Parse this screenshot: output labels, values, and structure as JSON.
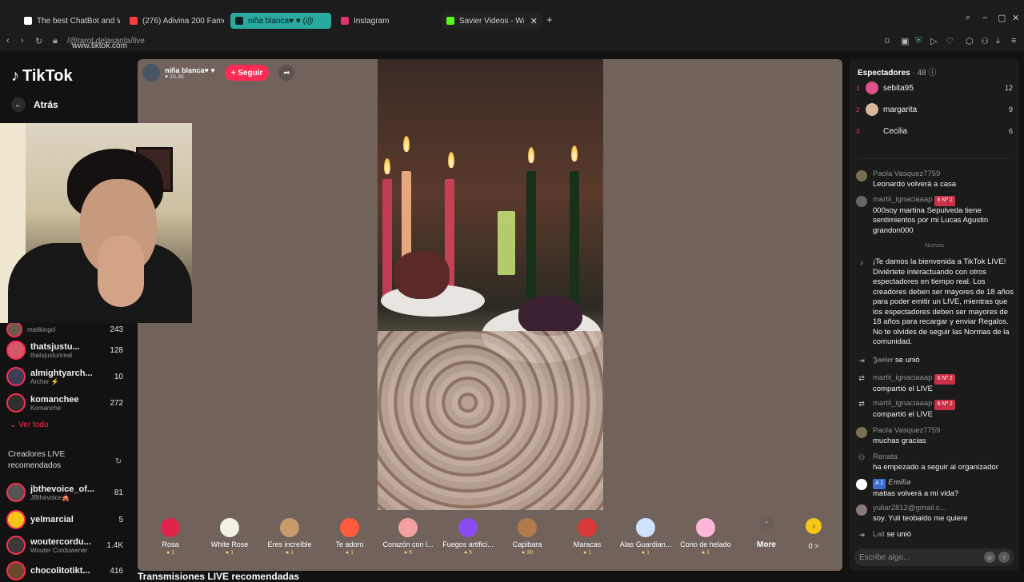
{
  "browser": {
    "tabs": [
      {
        "title": "The best ChatBot and Wr",
        "color": "#ffffff"
      },
      {
        "title": "(276) Adivina 200 Famos",
        "color": "#ff3d3d"
      },
      {
        "title": "niña blanca♥ ♥ (@",
        "color": "#ffffff"
      },
      {
        "title": "Instagram",
        "color": "#e1306c"
      },
      {
        "title": "Savier Videos - Watc",
        "color": "#53fc18"
      }
    ],
    "new_tab": "+",
    "close_tab": "✕",
    "url_host": "www.tiktok.com",
    "url_path": "/@tarot.delasanta/live"
  },
  "sidebar": {
    "brand": "TikTok",
    "back_label": "Atrás",
    "creators": [
      {
        "name": "matikingcl",
        "sub": "",
        "count": "243"
      },
      {
        "name": "thatsjustu...",
        "sub": "thatsjustunreal",
        "count": "128"
      },
      {
        "name": "almightyarch...",
        "sub": "Archer ⚡",
        "count": "10"
      },
      {
        "name": "komanchee",
        "sub": "Komanche",
        "count": "272"
      }
    ],
    "see_all": "Ver todo",
    "recommended_title": "Creadores LIVE recomendados",
    "recommended": [
      {
        "name": "jbthevoice_of...",
        "sub": "JBthevoice🎪",
        "count": "81"
      },
      {
        "name": "yelmarcial",
        "sub": "",
        "count": "5"
      },
      {
        "name": "woutercordu...",
        "sub": "Wouter Corduwener",
        "count": "1.4K"
      },
      {
        "name": "chocolitotikt...",
        "sub": "",
        "count": "416"
      }
    ]
  },
  "stream": {
    "host_name": "niña blanca♥ ♥",
    "host_likes": "♥ 16.3K",
    "follow_label": "+ Seguir",
    "below_title": "Transmisiones LIVE recomendadas"
  },
  "gifts": [
    {
      "label": "Rosa",
      "price": "1",
      "color": "#e0244c"
    },
    {
      "label": "White Rose",
      "price": "1",
      "color": "#f1f1e6"
    },
    {
      "label": "Eres increíble",
      "price": "1",
      "color": "#c79a6a"
    },
    {
      "label": "Te adoro",
      "price": "1",
      "color": "#ff5a3c"
    },
    {
      "label": "Corazón con l...",
      "price": "5",
      "color": "#f3a0a0"
    },
    {
      "label": "Fuegos artifici...",
      "price": "5",
      "color": "#8b4cf5"
    },
    {
      "label": "Capibara",
      "price": "30",
      "color": "#b07a4c"
    },
    {
      "label": "Maracas",
      "price": "1",
      "color": "#d83a3a"
    },
    {
      "label": "Alas Guardian...",
      "price": "1",
      "color": "#cfe3ff"
    },
    {
      "label": "Cono de helado",
      "price": "1",
      "color": "#ffb6d9"
    }
  ],
  "more_label": "More",
  "coins": "0 >",
  "chat": {
    "viewers_label": "Espectadores",
    "viewers_count": "· 48",
    "top_viewers": [
      {
        "rank": "1",
        "name": "sebita95",
        "count": "12",
        "color": "#e0508a"
      },
      {
        "rank": "2",
        "name": "margarita",
        "count": "9",
        "color": "#d8b79a"
      },
      {
        "rank": "3",
        "name": "Cecilia",
        "count": "6",
        "color": "#1b1b1b"
      }
    ],
    "new_label": "Nuevos",
    "messages": [
      {
        "user": "Paola Vasquez7759",
        "text": "Leonardo volverá a casa"
      },
      {
        "user": "martii_ignaciaaap",
        "badge": "6 Nº 2",
        "text": "000soy martina Sepulveda tiene sentimientos por mi Lucas Agustin grandon000"
      },
      {
        "user": "",
        "text": "¡Te damos la bienvenida a TikTok LIVE! Diviértete interactuando con otros espectadores en tiempo real. Los creadores deben ser mayores de 18 años para poder emitir un LIVE, mientras que los espectadores deben ser mayores de 18 años para recargar y enviar Regalos. No te olvides de seguir las Normas de la comunidad."
      },
      {
        "user": "𝕵𝖆𝖛𝖎𝖊𝖗",
        "text": "se unió"
      },
      {
        "user": "martii_ignaciaaap",
        "badge": "6 Nº 2",
        "text": "compartió el LIVE"
      },
      {
        "user": "martii_ignaciaaap",
        "badge": "6 Nº 2",
        "text": "compartió el LIVE"
      },
      {
        "user": "Paola Vasquez7759",
        "text": "muchas gracias"
      },
      {
        "user": "Renata",
        "text": "ha empezado a seguir al organizador"
      },
      {
        "user": "𝑬𝒎𝒊𝒍𝒊𝒂",
        "badge": "A 1",
        "text": "matias volverá a mi vida?"
      },
      {
        "user": "yuliar2812@gmail.c...",
        "text": "soy. Yuli teobaldo me quiere"
      },
      {
        "user": "Lali",
        "text": "se unió"
      }
    ],
    "input_placeholder": "Escribe algo..."
  }
}
